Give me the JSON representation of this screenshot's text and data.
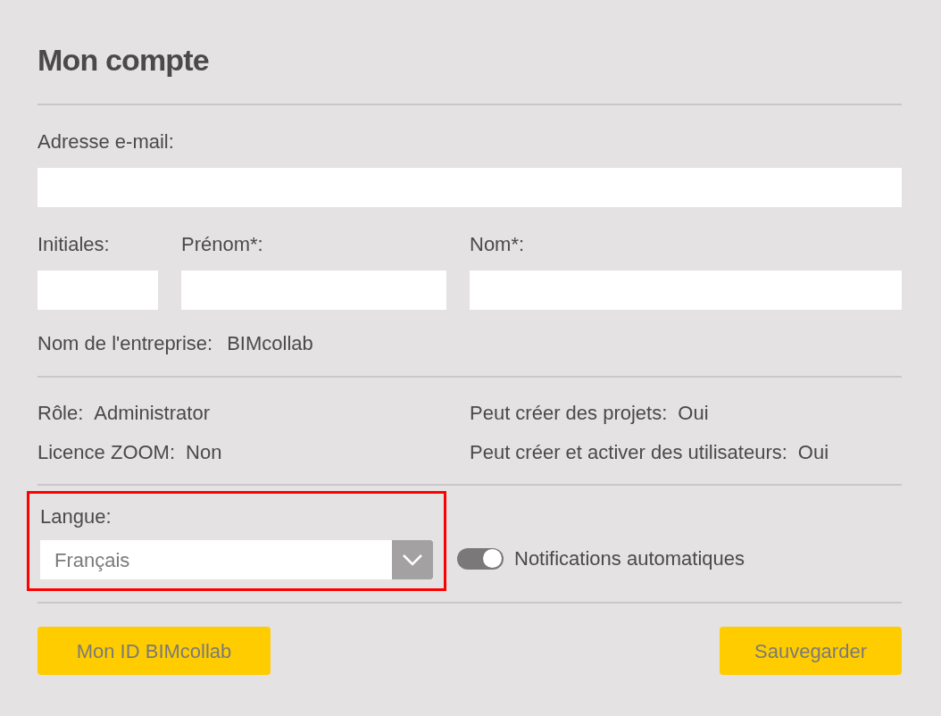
{
  "title": "Mon compte",
  "email": {
    "label": "Adresse e-mail:"
  },
  "name_fields": [
    {
      "label": "Initiales:"
    },
    {
      "label": "Prénom*:"
    },
    {
      "label": "Nom*:"
    }
  ],
  "company": {
    "label": "Nom de l'entreprise:",
    "value": "BIMcollab"
  },
  "info": [
    {
      "label": "Rôle:",
      "value": "Administrator"
    },
    {
      "label": "Peut créer des projets:",
      "value": "Oui"
    },
    {
      "label": "Licence ZOOM:",
      "value": "Non"
    },
    {
      "label": "Peut créer et activer des utilisateurs:",
      "value": "Oui"
    }
  ],
  "language": {
    "label": "Langue:",
    "value": "Français",
    "highlighted": true
  },
  "notifications": {
    "label": "Notifications automatiques",
    "on": true
  },
  "buttons": [
    {
      "label": "Mon ID BIMcollab"
    },
    {
      "label": "Sauvegarder"
    }
  ]
}
